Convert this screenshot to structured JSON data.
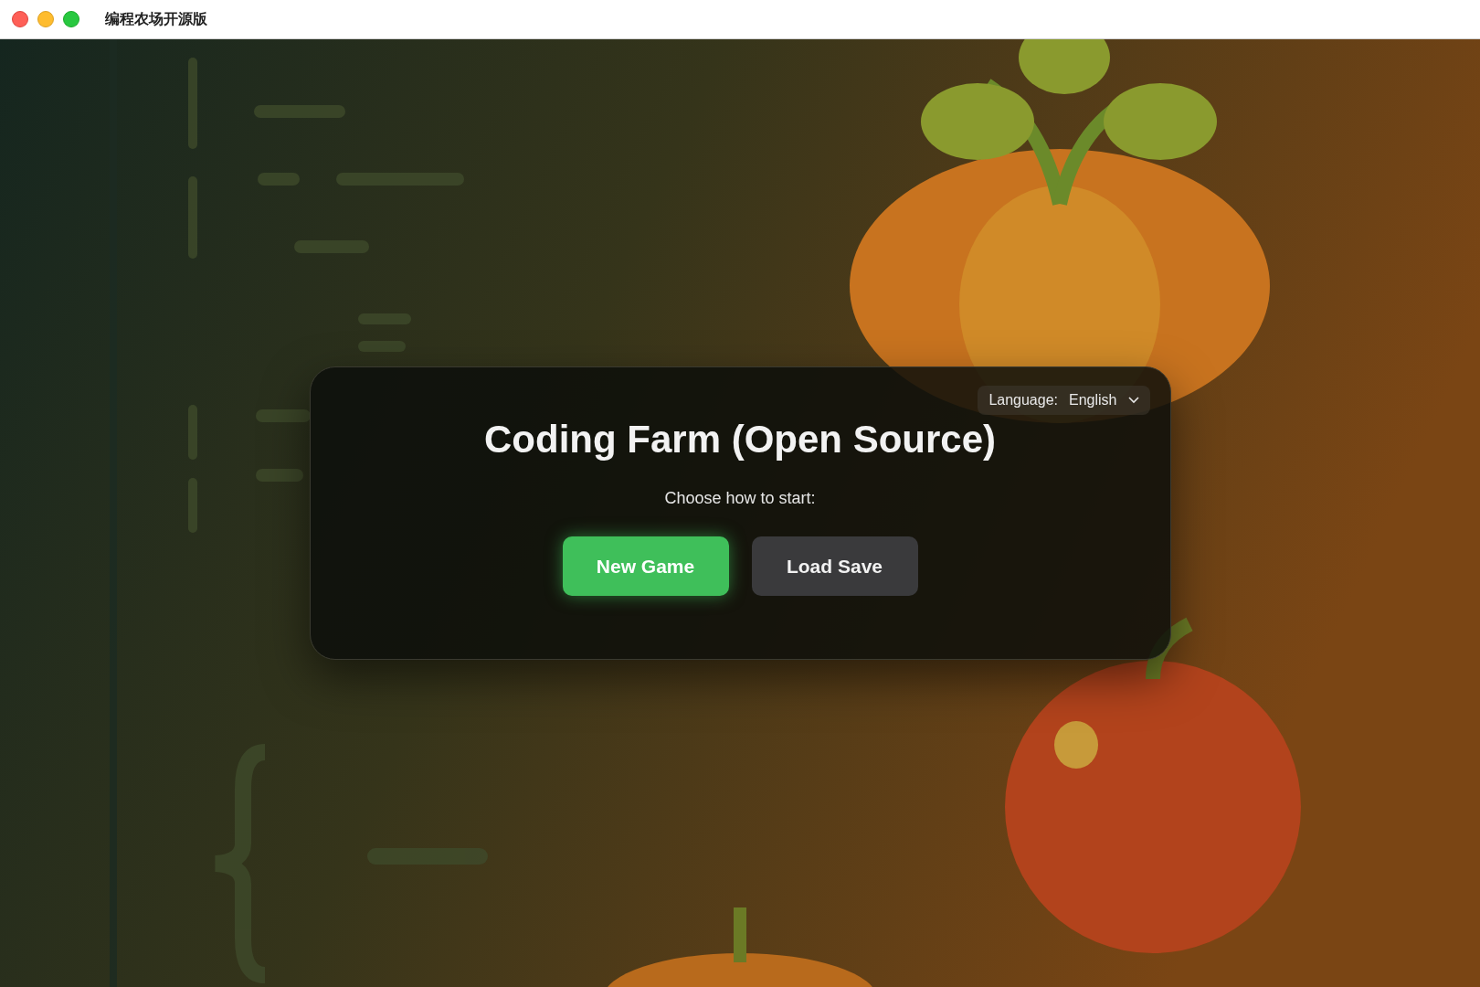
{
  "window": {
    "title": "编程农场开源版"
  },
  "language": {
    "label": "Language:",
    "value": "English"
  },
  "dialog": {
    "title": "Coding Farm (Open Source)",
    "prompt": "Choose how to start:"
  },
  "buttons": [
    {
      "label": "New Game",
      "kind": "primary"
    },
    {
      "label": "Load Save",
      "kind": "secondary"
    }
  ]
}
